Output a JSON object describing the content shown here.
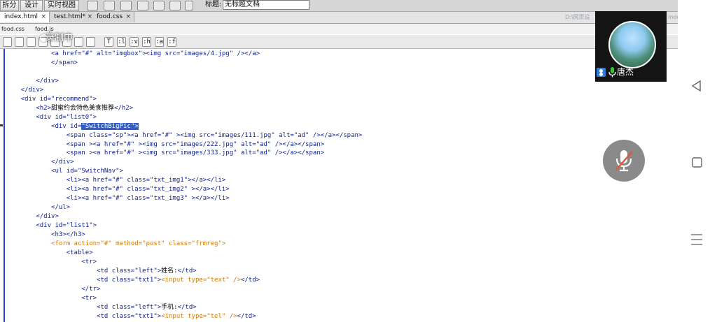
{
  "toolbar": {
    "split_label": "拆分",
    "design_label": "设计",
    "live_label": "实时视图",
    "title_label": "标题:",
    "title_value": "无标题文档"
  },
  "tabs": [
    {
      "label": "index.html",
      "close": "×"
    },
    {
      "label": "test.html*",
      "close": "×"
    },
    {
      "label": "food.css",
      "close": "×"
    }
  ],
  "path_text": "D:\\网页设",
  "path_tail": "inde",
  "related_files": [
    "food.css",
    "food.js"
  ],
  "recording_label": "录制中",
  "code_toolbar_text": [
    "T",
    ":l",
    ":v",
    ":h",
    ":a",
    ":f"
  ],
  "code_lines": [
    "            <a href=\"#\" alt=\"imgbox\"><img src=\"images/4.jpg\" /></a>",
    "            </span>",
    "",
    "        </div>",
    "    </div>",
    "    <div id=\"recommend\">",
    "        <h2>甜蜜约会特色美食推荐</h2>",
    "        <div id=\"list0\">",
    "            <div id=\"SwitchBigPic\">",
    "                <span class=\"sp\"><a href=\"#\" ><img src=\"images/111.jpg\" alt=\"ad\" /></a></span>",
    "                <span ><a href=\"#\" ><img src=\"images/222.jpg\" alt=\"ad\" /></a></span>",
    "                <span ><a href=\"#\" ><img src=\"images/333.jpg\" alt=\"ad\" /></a></span>",
    "            </div>",
    "            <ul id=\"SwitchNav\">",
    "                <li><a href=\"#\" class=\"txt_img1\"></a></li>",
    "                <li><a href=\"#\" class=\"txt_img2\" ></a></li>",
    "                <li><a href=\"#\" class=\"txt_img3\" ></a></li>",
    "            </ul>",
    "        </div>",
    "        <div id=\"list1\">",
    "            <h3></h3>",
    "            <form action=\"#\" method=\"post\" class=\"frmreg\">",
    "                <table>",
    "                    <tr>",
    "                        <td class=\"left\">姓名:</td>",
    "                        <td class=\"txt1\"><input type=\"text\" /></td>",
    "                    </tr>",
    "                    <tr>",
    "                        <td class=\"left\">手机:</td>",
    "                        <td class=\"txt1\"><input type=\"tel\" /></td>"
  ],
  "selected_text": "\"SwitchBigPic\">",
  "call": {
    "caller_name": "唐杰"
  },
  "colors": {
    "tag": "#0b1f8f",
    "form_tag": "#d47a00",
    "selection": "#2f5ec9",
    "gutter": "#2a3fd6"
  },
  "icons": [
    "split-view-icon",
    "live-view-icon",
    "mic-icon",
    "mic-off-icon",
    "back-triangle-icon",
    "home-square-icon",
    "menu-lines-icon"
  ]
}
